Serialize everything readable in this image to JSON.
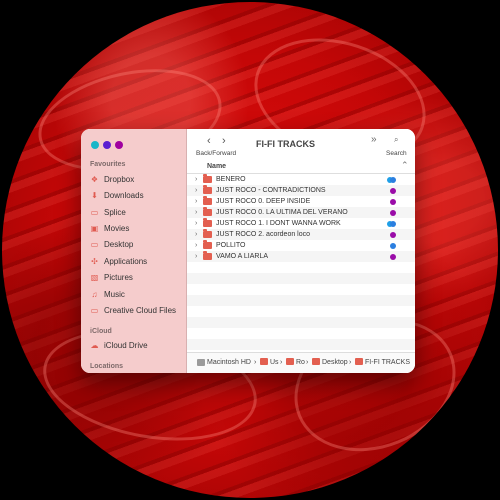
{
  "window": {
    "title": "FI-FI TRACKS",
    "toolbar": {
      "back_forward_label": "Back/Forward",
      "search_label": "Search"
    },
    "header": {
      "name_label": "Name"
    },
    "traffic_lights": [
      "#18b6c8",
      "#5b1fd1",
      "#a0009f"
    ]
  },
  "sidebar": {
    "favourites_label": "Favourites",
    "icloud_label": "iCloud",
    "locations_label": "Locations",
    "items": [
      {
        "label": "Dropbox",
        "icon": "dropbox-icon"
      },
      {
        "label": "Downloads",
        "icon": "downloads-icon"
      },
      {
        "label": "Splice",
        "icon": "folder-icon"
      },
      {
        "label": "Movies",
        "icon": "movies-icon"
      },
      {
        "label": "Desktop",
        "icon": "desktop-icon"
      },
      {
        "label": "Applications",
        "icon": "applications-icon"
      },
      {
        "label": "Pictures",
        "icon": "pictures-icon"
      },
      {
        "label": "Music",
        "icon": "music-icon"
      },
      {
        "label": "Creative Cloud Files",
        "icon": "folder-icon"
      }
    ],
    "icloud_items": [
      {
        "label": "iCloud Drive",
        "icon": "cloud-icon"
      }
    ]
  },
  "files": [
    {
      "name": "BENERO",
      "tags": [
        "#1f9fe7",
        "#2b7fe0"
      ]
    },
    {
      "name": "JUST ROCO - CONTRADICTIONS",
      "tags": [
        "#9a0ca8"
      ]
    },
    {
      "name": "JUST ROCO 0. DEEP INSIDE",
      "tags": [
        "#9a0ca8"
      ]
    },
    {
      "name": "JUST ROCO 0. LA ULTIMA DEL VERANO",
      "tags": [
        "#9a0ca8"
      ]
    },
    {
      "name": "JUST ROCO 1. I DONT WANNA WORK",
      "tags": [
        "#1f9fe7",
        "#2b7fe0"
      ]
    },
    {
      "name": "JUST ROCO 2. acordeon loco",
      "tags": [
        "#9a0ca8"
      ]
    },
    {
      "name": "POLLITO",
      "tags": [
        "#2b7fe0"
      ]
    },
    {
      "name": "VAMO A LIARLA",
      "tags": [
        "#9a0ca8"
      ]
    }
  ],
  "path": {
    "items": [
      "Macintosh HD",
      "Us",
      "Ro",
      "Desktop",
      "FI-FI TRACKS"
    ],
    "separator": "›"
  },
  "colors": {
    "accent": "#e35f50",
    "sidebar_background": "#f5cccc"
  }
}
